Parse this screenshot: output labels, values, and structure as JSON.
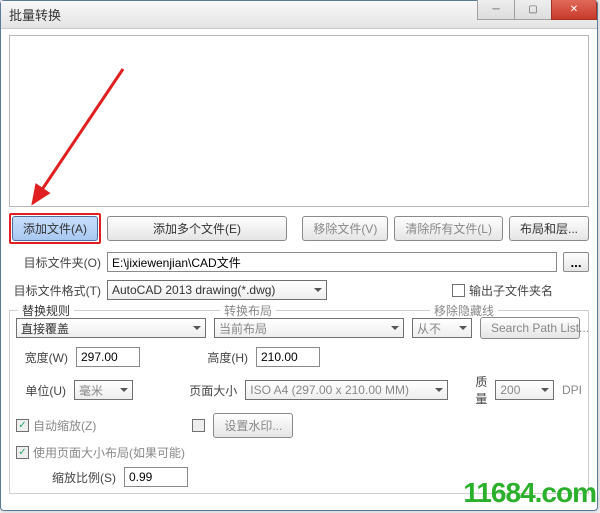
{
  "window": {
    "title": "批量转换"
  },
  "buttons": {
    "add_file": "添加文件(A)",
    "add_multi": "添加多个文件(E)",
    "remove_file": "移除文件(V)",
    "clear_all": "清除所有文件(L)",
    "layout_layers": "布局和层...",
    "browse": "...",
    "set_watermark": "设置水印...",
    "search_path": "Search Path List..."
  },
  "labels": {
    "target_folder": "目标文件夹(O)",
    "target_format": "目标文件格式(T)",
    "output_subname": "输出子文件夹名",
    "replace_rules": "替换规则",
    "convert_layout": "转换布局",
    "remove_hidden": "移除隐藏线",
    "width": "宽度(W)",
    "height": "高度(H)",
    "unit": "单位(U)",
    "page_size": "页面大小",
    "quality": "质量",
    "dpi": "DPI",
    "auto_scale": "自动缩放(Z)",
    "use_page_layout": "使用页面大小布局(如果可能)",
    "zoom_ratio": "缩放比例(S)"
  },
  "values": {
    "target_folder": "E:\\jixiewenjian\\CAD文件",
    "target_format": "AutoCAD 2013 drawing(*.dwg)",
    "replace_rule": "直接覆盖",
    "convert_layout": "当前布局",
    "remove_hidden": "从不",
    "width": "297.00",
    "height": "210.00",
    "unit": "毫米",
    "page_size": "ISO A4 (297.00 x 210.00 MM)",
    "quality": "200",
    "zoom_ratio": "0.99"
  },
  "checks": {
    "output_subname": false,
    "auto_scale": true,
    "watermark_enable": false,
    "use_page_layout": true
  },
  "watermark": "11684.com"
}
